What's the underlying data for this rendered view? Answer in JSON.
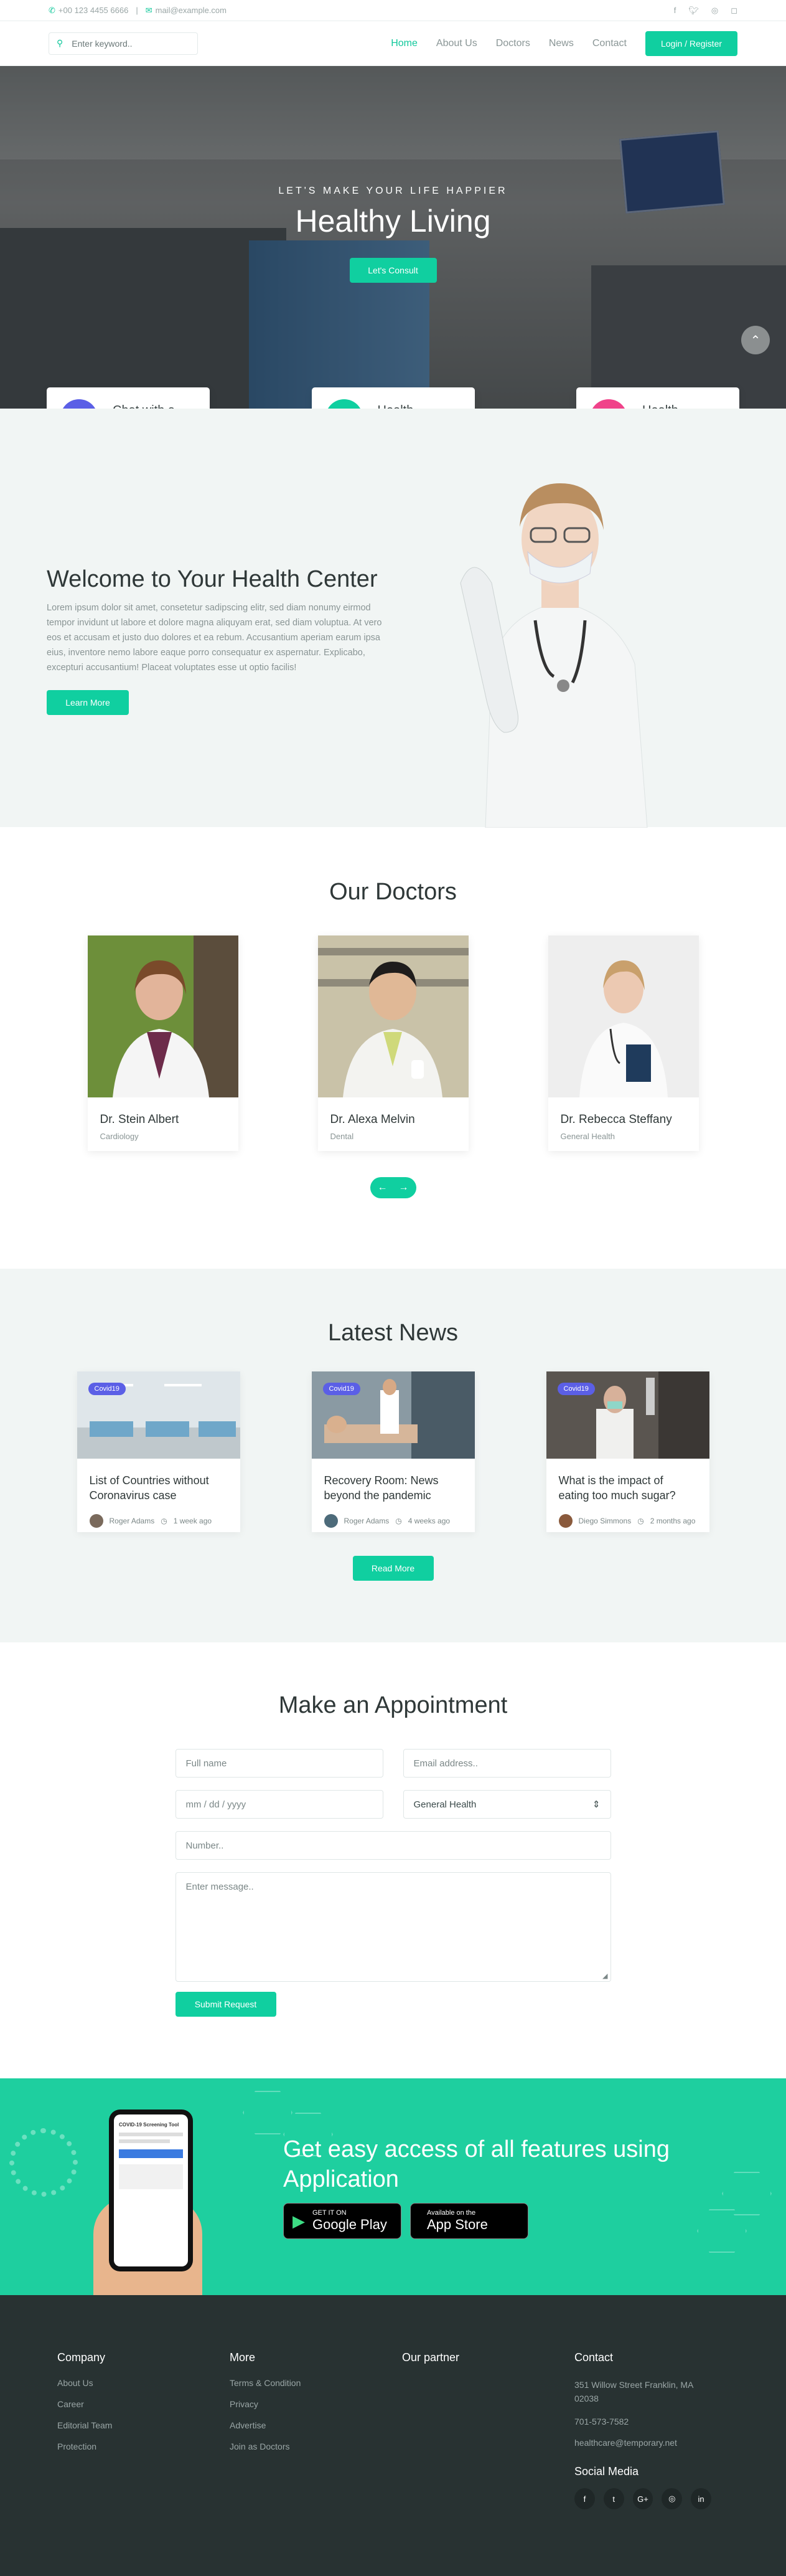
{
  "topbar": {
    "phone": "+00 123 4455 6666",
    "email": "mail@example.com",
    "separator": "|",
    "social_icons": [
      "facebook-icon",
      "twitter-icon",
      "dribbble-icon",
      "instagram-icon"
    ]
  },
  "nav": {
    "search_placeholder": "Enter keyword..",
    "items": [
      "Home",
      "About Us",
      "Doctors",
      "News",
      "Contact"
    ],
    "login": "Login / Register"
  },
  "hero": {
    "kicker": "LET'S MAKE YOUR LIFE HAPPIER",
    "title": "Healthy Living",
    "cta": "Let's Consult"
  },
  "features": [
    {
      "label": "Chat with a doctors",
      "color": "#5b5fe6",
      "icon": "chat-icon"
    },
    {
      "label": "Health Protection",
      "color": "#10cfa0",
      "icon": "shield-icon"
    },
    {
      "label": "Health Pharmacy",
      "color": "#f0438a",
      "icon": "basket-icon"
    }
  ],
  "welcome": {
    "title": "Welcome to Your Health Center",
    "body": "Lorem ipsum dolor sit amet, consetetur sadipscing elitr, sed diam nonumy eirmod tempor invidunt ut labore et dolore magna aliquyam erat, sed diam voluptua. At vero eos et accusam et justo duo dolores et ea rebum. Accusantium aperiam earum ipsa eius, inventore nemo labore eaque porro consequatur ex aspernatur. Explicabo, excepturi accusantium! Placeat voluptates esse ut optio facilis!",
    "cta": "Learn More"
  },
  "doctors": {
    "title": "Our Doctors",
    "items": [
      {
        "name": "Dr. Stein Albert",
        "specialty": "Cardiology"
      },
      {
        "name": "Dr. Alexa Melvin",
        "specialty": "Dental"
      },
      {
        "name": "Dr. Rebecca Steffany",
        "specialty": "General Health"
      }
    ]
  },
  "news": {
    "title": "Latest News",
    "more": "Read More",
    "items": [
      {
        "tag": "Covid19",
        "title": "List of Countries without Coronavirus case",
        "author": "Roger Adams",
        "time": "1 week ago"
      },
      {
        "tag": "Covid19",
        "title": "Recovery Room: News beyond the pandemic",
        "author": "Roger Adams",
        "time": "4 weeks ago"
      },
      {
        "tag": "Covid19",
        "title": "What is the impact of eating too much sugar?",
        "author": "Diego Simmons",
        "time": "2 months ago"
      }
    ]
  },
  "appointment": {
    "title": "Make an Appointment",
    "name_ph": "Full name",
    "email_ph": "Email address..",
    "date_ph": "mm / dd / yyyy",
    "dept": "General Health",
    "number_ph": "Number..",
    "message_ph": "Enter message..",
    "submit": "Submit Request"
  },
  "app": {
    "title": "Get easy access of all features using Application",
    "phone_title": "COVID-19 Screening Tool",
    "google_small": "GET IT ON",
    "google_big": "Google Play",
    "apple_small": "Available on the",
    "apple_big": "App Store"
  },
  "footer": {
    "company": {
      "title": "Company",
      "links": [
        "About Us",
        "Career",
        "Editorial Team",
        "Protection"
      ]
    },
    "more": {
      "title": "More",
      "links": [
        "Terms & Condition",
        "Privacy",
        "Advertise",
        "Join as Doctors"
      ]
    },
    "partner": {
      "title": "Our partner"
    },
    "contact": {
      "title": "Contact",
      "address": "351 Willow Street Franklin, MA 02038",
      "phone": "701-573-7582",
      "email": "healthcare@temporary.net"
    },
    "social_title": "Social Media",
    "social_icons": [
      "facebook-icon",
      "twitter-icon",
      "google-plus-icon",
      "instagram-icon",
      "linkedin-icon"
    ],
    "google_glyph": "G+"
  }
}
